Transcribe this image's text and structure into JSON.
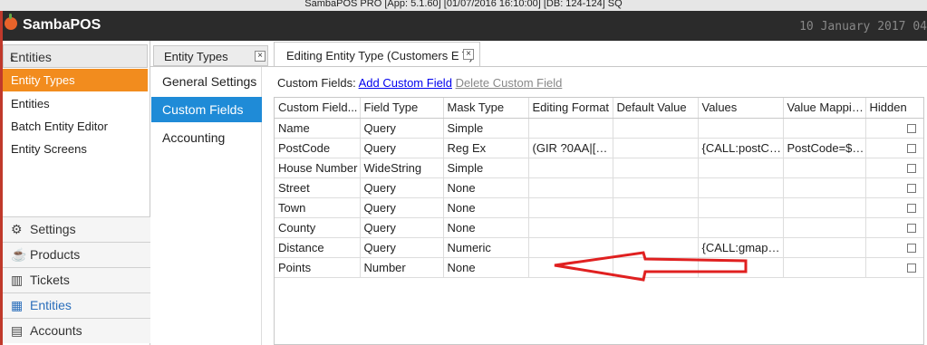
{
  "window": {
    "title": "SambaPOS PRO [App: 5.1.60] [01/07/2016 16:10:00] [DB: 124-124] SQ"
  },
  "header": {
    "brand": "SambaPOS",
    "datetime": "10 January 2017 04"
  },
  "left_panel": {
    "title": "Entities",
    "collapse_glyph": "‹",
    "items": [
      {
        "label": "Entity Types",
        "active": true
      },
      {
        "label": "Entities"
      },
      {
        "label": "Batch Entity Editor"
      },
      {
        "label": "Entity Screens"
      }
    ]
  },
  "nav": [
    {
      "label": "Settings",
      "icon": "gear-icon",
      "glyph": "⚙"
    },
    {
      "label": "Products",
      "icon": "coffee-icon",
      "glyph": "☕"
    },
    {
      "label": "Tickets",
      "icon": "books-icon",
      "glyph": "▥"
    },
    {
      "label": "Entities",
      "icon": "table-icon",
      "glyph": "▦",
      "active": true
    },
    {
      "label": "Accounts",
      "icon": "calculator-icon",
      "glyph": "▤"
    }
  ],
  "tabs": [
    {
      "label": "Entity Types",
      "close": "×"
    },
    {
      "label": "Editing Entity Type (Customers E T)",
      "close": "×"
    }
  ],
  "sub_menu": [
    {
      "label": "General Settings"
    },
    {
      "label": "Custom Fields",
      "active": true
    },
    {
      "label": "Accounting"
    }
  ],
  "custom_fields": {
    "label": "Custom Fields:",
    "add": "Add Custom Field",
    "delete": "Delete Custom Field"
  },
  "grid": {
    "columns": [
      "Custom Field...",
      "Field Type",
      "Mask Type",
      "Editing Format",
      "Default Value",
      "Values",
      "Value Mappin...",
      "Hidden"
    ],
    "rows": [
      [
        "Name",
        "Query",
        "Simple",
        "",
        "",
        "",
        ""
      ],
      [
        "PostCode",
        "Query",
        "Reg Ex",
        "(GIR ?0AA|[A-...",
        "",
        "{CALL:postCo...",
        "PostCode=$1..."
      ],
      [
        "House Number",
        "WideString",
        "Simple",
        "",
        "",
        "",
        ""
      ],
      [
        "Street",
        "Query",
        "None",
        "",
        "",
        "",
        ""
      ],
      [
        "Town",
        "Query",
        "None",
        "",
        "",
        "",
        ""
      ],
      [
        "County",
        "Query",
        "None",
        "",
        "",
        "",
        ""
      ],
      [
        "Distance",
        "Query",
        "Numeric",
        "",
        "",
        "{CALL:gmaps....",
        ""
      ],
      [
        "Points",
        "Number",
        "None",
        "",
        "",
        "",
        ""
      ]
    ]
  },
  "colors": {
    "accent_orange": "#f28c1e",
    "accent_blue": "#1f8bd7",
    "annotation_red": "#e02020"
  }
}
